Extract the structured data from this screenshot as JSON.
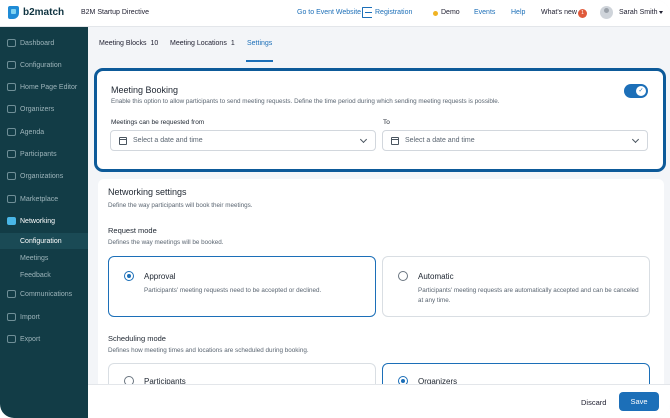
{
  "topbar": {
    "brand": "b2match",
    "event_name": "B2M Startup Directive",
    "go_to_event": "Go to Event Website",
    "registration": "Registration",
    "demo": "Demo",
    "events": "Events",
    "help": "Help",
    "whats_new": "What's new",
    "whats_new_badge": "1",
    "user_name": "Sarah Smith"
  },
  "sidebar": {
    "items": [
      {
        "label": "Dashboard"
      },
      {
        "label": "Configuration"
      },
      {
        "label": "Home Page Editor"
      },
      {
        "label": "Organizers"
      },
      {
        "label": "Agenda"
      },
      {
        "label": "Participants"
      },
      {
        "label": "Organizations"
      },
      {
        "label": "Marketplace"
      },
      {
        "label": "Networking"
      },
      {
        "label": "Communications"
      },
      {
        "label": "Import"
      },
      {
        "label": "Export"
      }
    ],
    "subitems": [
      {
        "label": "Configuration"
      },
      {
        "label": "Meetings"
      },
      {
        "label": "Feedback"
      }
    ]
  },
  "tabs": [
    {
      "label": "Meeting Blocks",
      "count": "10"
    },
    {
      "label": "Meeting Locations",
      "count": "1"
    },
    {
      "label": "Settings",
      "count": ""
    }
  ],
  "booking": {
    "title": "Meeting Booking",
    "description": "Enable this option to allow participants to send meeting requests. Define the time period during which sending meeting requests is possible.",
    "enabled": true,
    "from_label": "Meetings can be requested from",
    "from_placeholder": "Select a date and time",
    "to_label": "To",
    "to_placeholder": "Select a date and time"
  },
  "networking": {
    "title": "Networking settings",
    "description": "Define the way participants will book their meetings.",
    "request_mode": {
      "title": "Request mode",
      "description": "Defines the way meetings will be booked.",
      "options": [
        {
          "label": "Approval",
          "description": "Participants' meeting requests need to be accepted or declined.",
          "selected": true
        },
        {
          "label": "Automatic",
          "description": "Participants' meeting requests are automatically accepted and can be canceled at any time.",
          "selected": false
        }
      ]
    },
    "scheduling_mode": {
      "title": "Scheduling mode",
      "description": "Defines how meeting times and locations are scheduled during booking.",
      "options": [
        {
          "label": "Participants",
          "selected": false
        },
        {
          "label": "Organizers",
          "selected": true
        }
      ]
    }
  },
  "footer": {
    "discard": "Discard",
    "save": "Save"
  },
  "colors": {
    "accent": "#1c6fb8",
    "sidebar_bg": "#123c46",
    "highlight_border": "#0d5a99"
  }
}
